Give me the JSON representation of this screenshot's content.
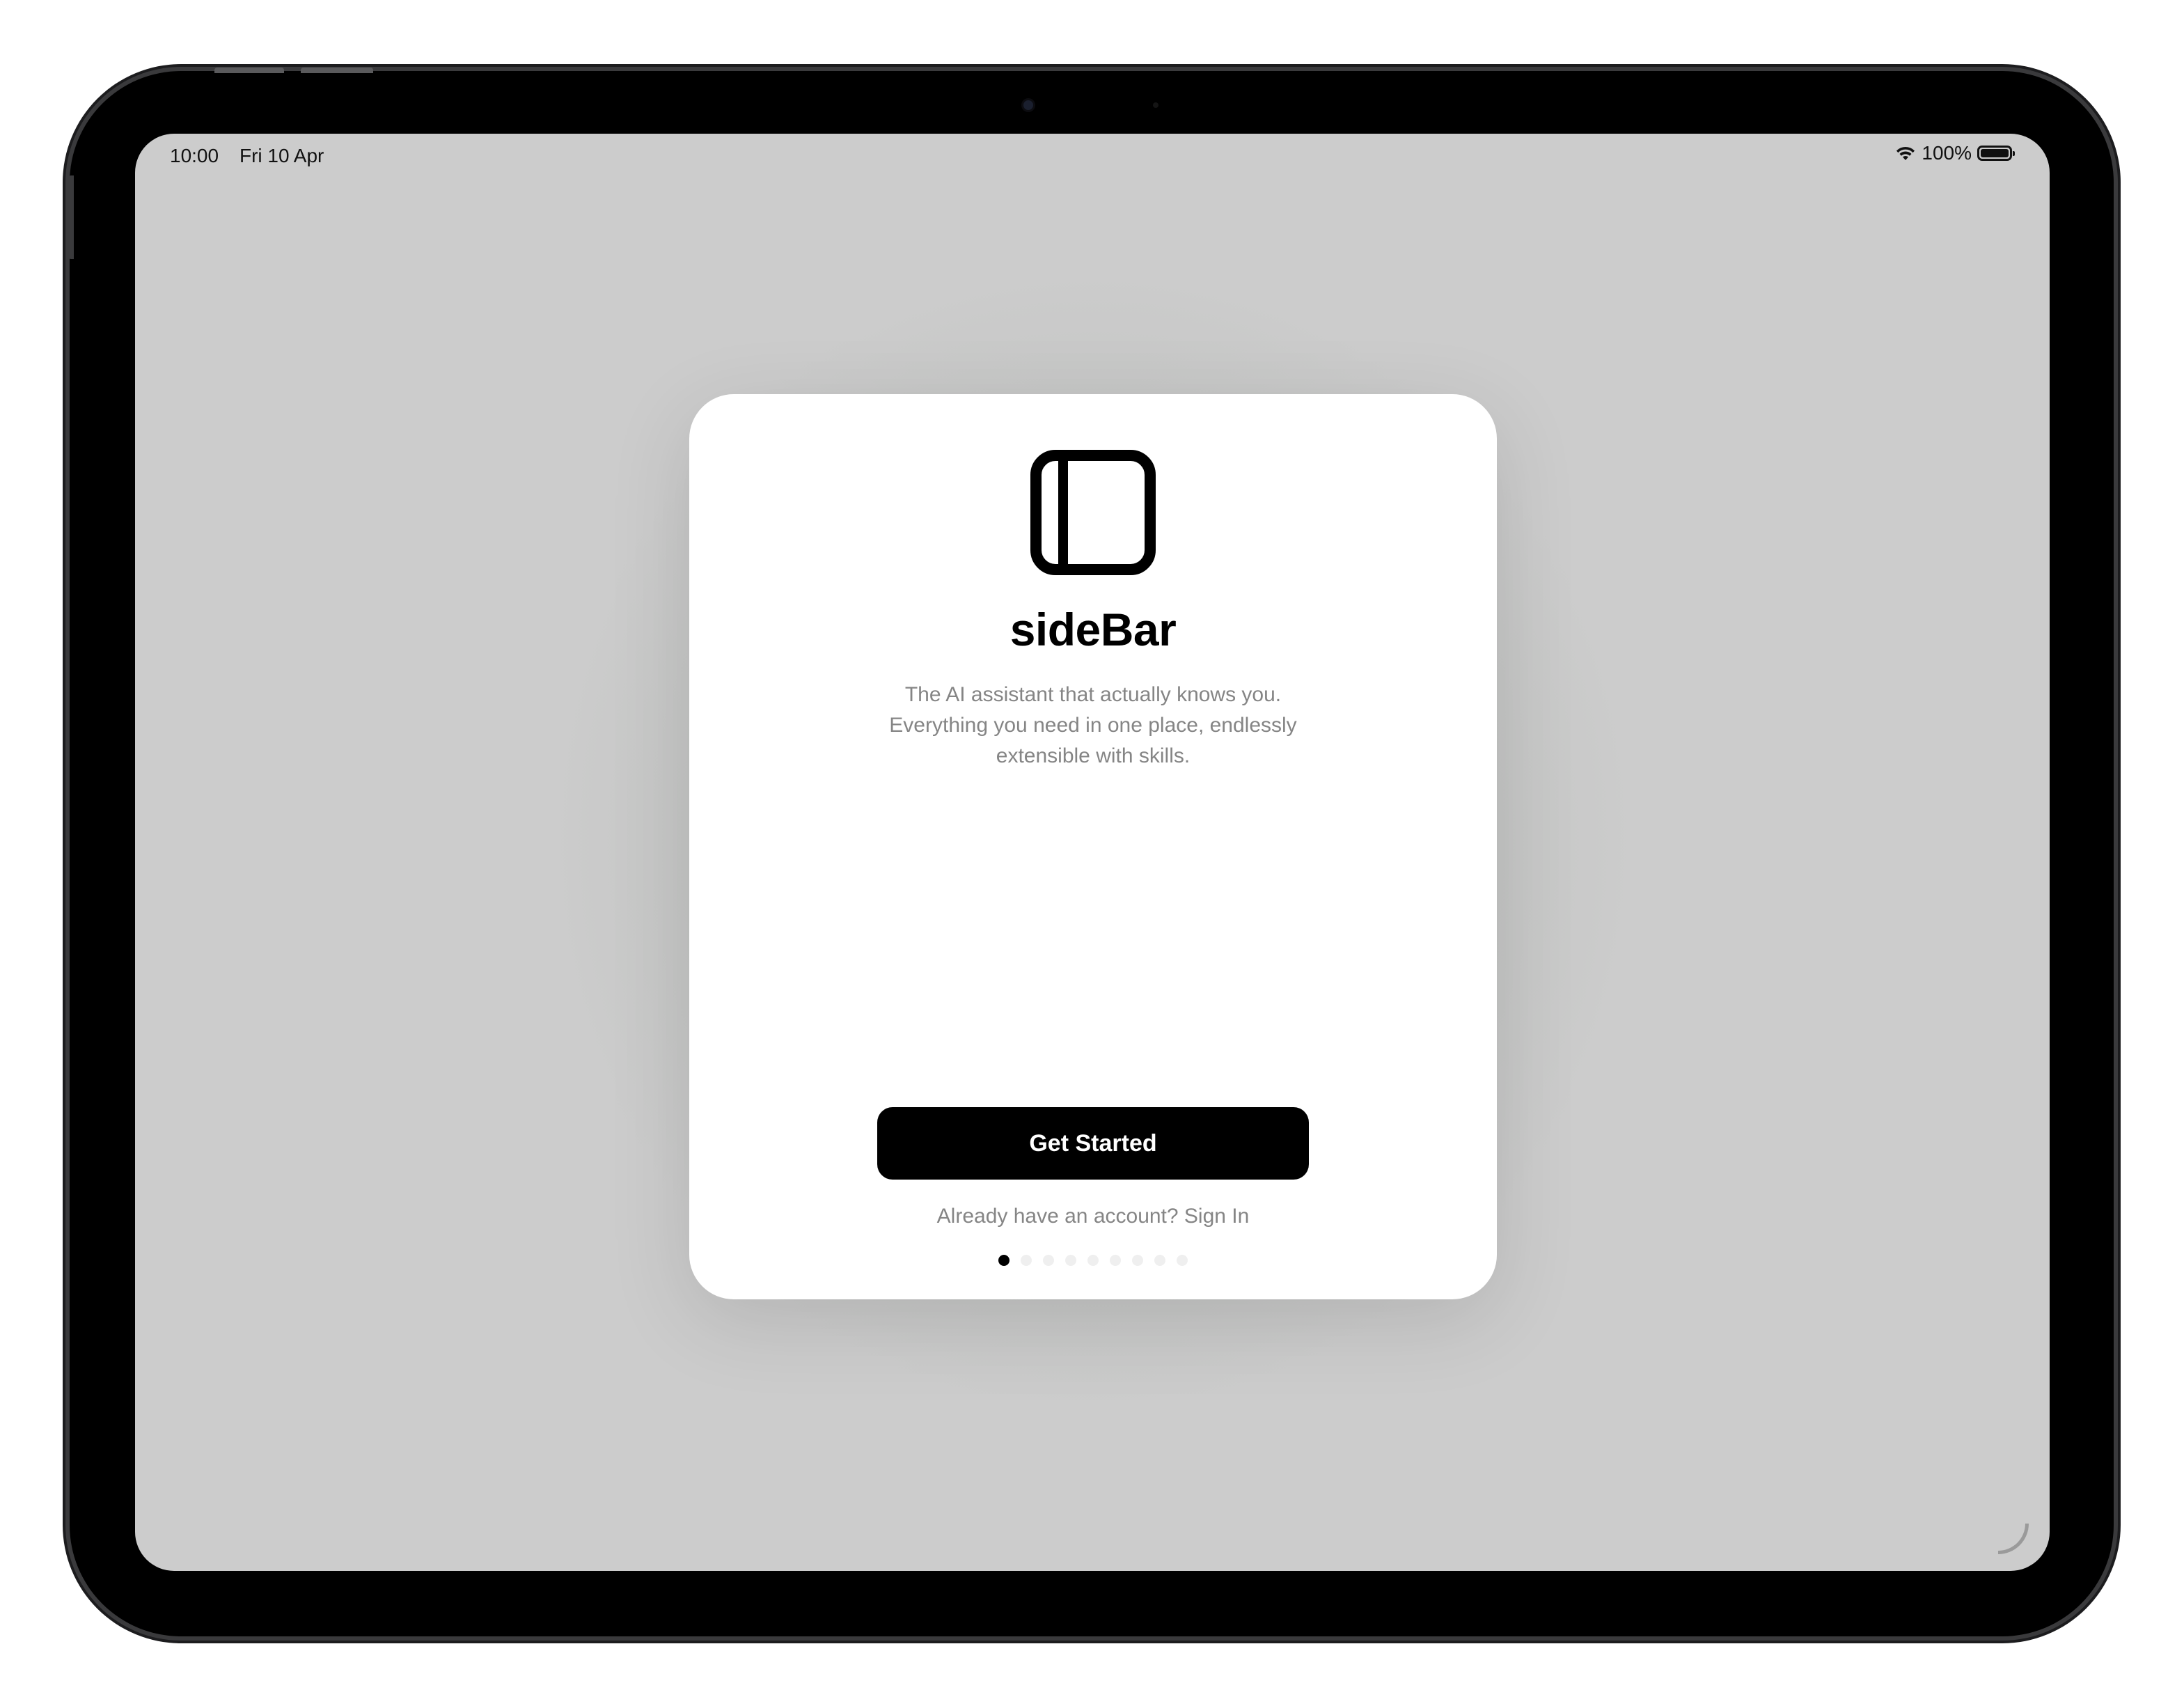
{
  "status_bar": {
    "time": "10:00",
    "date": "Fri 10 Apr",
    "battery_percent": "100%",
    "battery_level": 1.0,
    "wifi_icon": "wifi-icon",
    "battery_icon": "battery-icon"
  },
  "onboarding": {
    "app_icon": "sidebar-icon",
    "title": "sideBar",
    "tagline": "The AI assistant that actually knows you. Everything you need in one place, endlessly extensible with skills.",
    "primary_button": "Get Started",
    "sign_in_link": "Already have an account? Sign In",
    "page_count": 9,
    "current_page": 1
  },
  "colors": {
    "screen_background": "#cccccc",
    "card_background": "#ffffff",
    "button_background": "#000000",
    "button_text": "#ffffff",
    "secondary_text": "#858585"
  }
}
